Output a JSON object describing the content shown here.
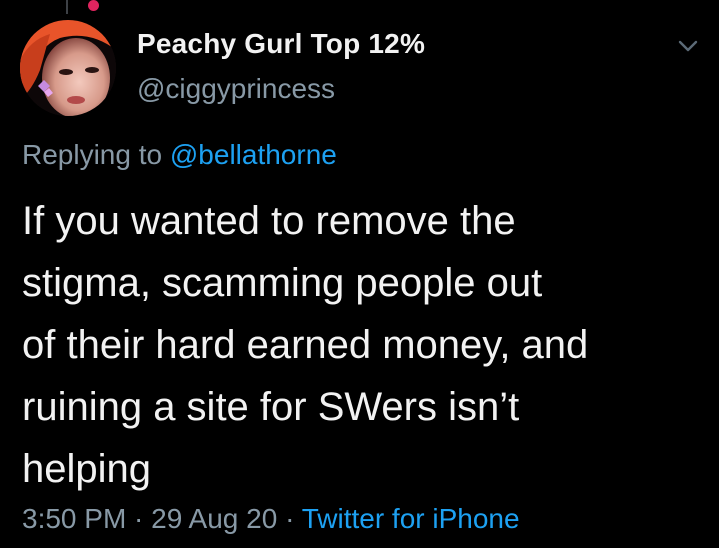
{
  "tweet": {
    "display_name": "Peachy Gurl Top 12%",
    "handle": "@ciggyprincess",
    "replying_prefix": "Replying to",
    "replying_mention": "@bellathorne",
    "text_lines": [
      "If you wanted to remove the",
      "stigma, scamming people out",
      "of their hard earned money, and",
      "ruining a site for SWers isn’t",
      "helping"
    ],
    "time": "3:50 PM",
    "separator": " · ",
    "date": "29 Aug 20",
    "source": "Twitter for iPhone"
  },
  "icons": {
    "menu": "chevron-down-icon",
    "avatar": "avatar"
  },
  "colors": {
    "background": "#000000",
    "primary_text": "#f2f2f2",
    "secondary_text": "#8899a6",
    "link": "#1da1f2",
    "notification": "#e0245e"
  }
}
